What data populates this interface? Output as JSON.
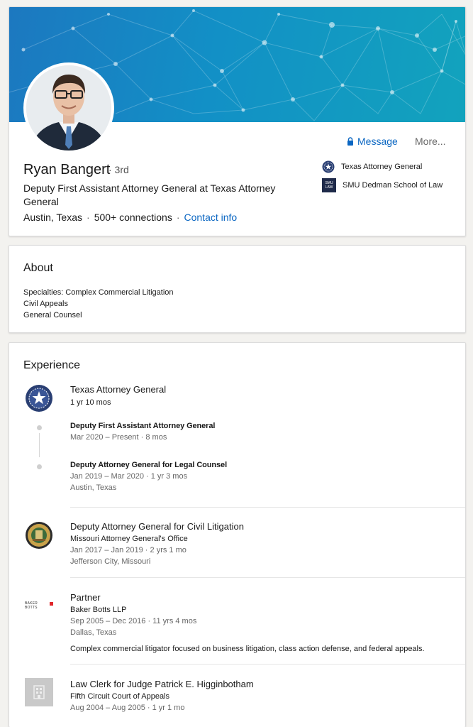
{
  "profile": {
    "name": "Ryan Bangert",
    "degree": "· 3rd",
    "headline": "Deputy First Assistant Attorney General at Texas Attorney General",
    "location": "Austin, Texas",
    "connections": "500+ connections",
    "contact_info": "Contact info",
    "separator": "·",
    "message_label": "Message",
    "more_label": "More...",
    "orgs": [
      "Texas Attorney General",
      "SMU Dedman School of Law"
    ],
    "smu_logo_text": "SMU LAW"
  },
  "about": {
    "title": "About",
    "lines": [
      "Specialties: Complex Commercial Litigation",
      "Civil Appeals",
      "General Counsel"
    ]
  },
  "experience": {
    "title": "Experience",
    "items": [
      {
        "company": "Texas Attorney General",
        "duration": "1 yr 10 mos",
        "roles": [
          {
            "title": "Deputy First Assistant Attorney General",
            "dates": "Mar 2020 – Present · 8 mos"
          },
          {
            "title": "Deputy Attorney General for Legal Counsel",
            "dates": "Jan 2019 – Mar 2020 · 1 yr 3 mos",
            "location": "Austin, Texas"
          }
        ]
      },
      {
        "title": "Deputy Attorney General for Civil Litigation",
        "company": "Missouri Attorney General's Office",
        "dates": "Jan 2017 – Jan 2019 · 2 yrs 1 mo",
        "location": "Jefferson City, Missouri"
      },
      {
        "title": "Partner",
        "company": "Baker Botts LLP",
        "dates": "Sep 2005 – Dec 2016 · 11 yrs 4 mos",
        "location": "Dallas, Texas",
        "description": "Complex commercial litigator focused on business litigation, class action defense, and federal appeals.",
        "logo_text": "BAKER BOTTS"
      },
      {
        "title": "Law Clerk for Judge Patrick E. Higginbotham",
        "company": "Fifth Circuit Court of Appeals",
        "dates": "Aug 2004 – Aug 2005 · 1 yr 1 mo"
      }
    ]
  },
  "colors": {
    "accent": "#0a66c2",
    "banner_start": "#1c78c0",
    "banner_end": "#12a3bd"
  }
}
